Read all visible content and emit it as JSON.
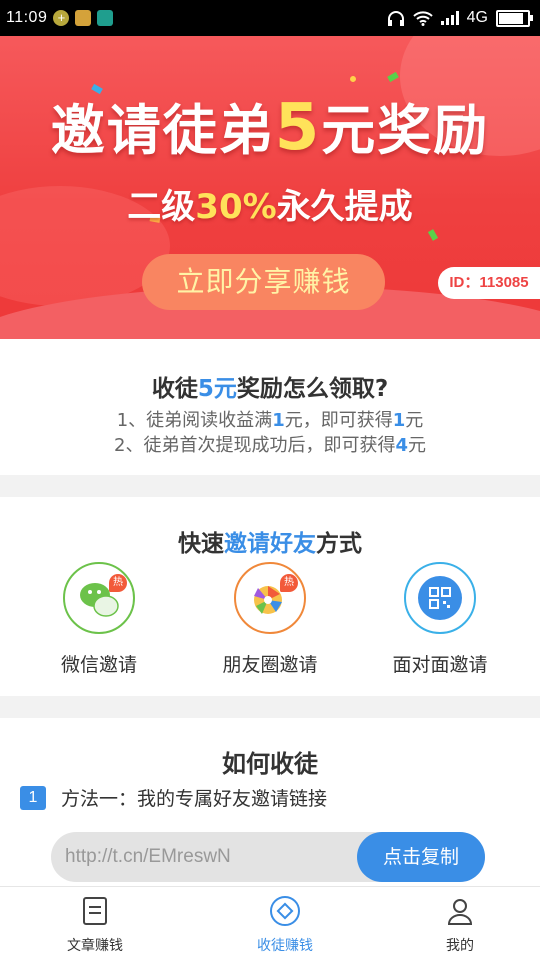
{
  "status_bar": {
    "time": "11:09",
    "network": "4G"
  },
  "banner": {
    "title_pre": "邀请徒弟",
    "title_num": "5",
    "title_post": "元奖励",
    "sub_pre": "二级",
    "sub_hl": "30%",
    "sub_post": "永久提成",
    "share_button": "立即分享赚钱",
    "id_tag": "ID：113085"
  },
  "reward": {
    "title_pre": "收徒",
    "title_hl": "5元",
    "title_post": "奖励怎么领取?",
    "line1_pre": "1、徒弟阅读收益满",
    "line1_b1": "1",
    "line1_mid": "元，即可获得",
    "line1_b2": "1",
    "line1_post": "元",
    "line2_pre": "2、徒弟首次提现成功后，即可获得",
    "line2_b": "4",
    "line2_post": "元"
  },
  "quick": {
    "title_pre": "快速",
    "title_hl": "邀请好友",
    "title_post": "方式",
    "items": [
      {
        "label": "微信邀请",
        "icon": "wechat-icon",
        "color": "#6cc24a"
      },
      {
        "label": "朋友圈邀请",
        "icon": "moments-icon",
        "color": "#f0883a"
      },
      {
        "label": "面对面邀请",
        "icon": "qrcode-icon",
        "color": "#3a8ee6"
      }
    ],
    "hot_badge": "热"
  },
  "how": {
    "title": "如何收徒",
    "method_number": "1",
    "method_text": "方法一：我的专属好友邀请链接",
    "link": "http://t.cn/EMreswN",
    "copy_button": "点击复制"
  },
  "nav": {
    "items": [
      {
        "label": "文章赚钱",
        "icon": "article-icon",
        "active": false
      },
      {
        "label": "收徒赚钱",
        "icon": "invite-icon",
        "active": true
      },
      {
        "label": "我的",
        "icon": "profile-icon",
        "active": false
      }
    ]
  },
  "colors": {
    "accent": "#3a8ee6",
    "banner_red": "#ef4040",
    "highlight_yellow": "#ffe25a"
  }
}
